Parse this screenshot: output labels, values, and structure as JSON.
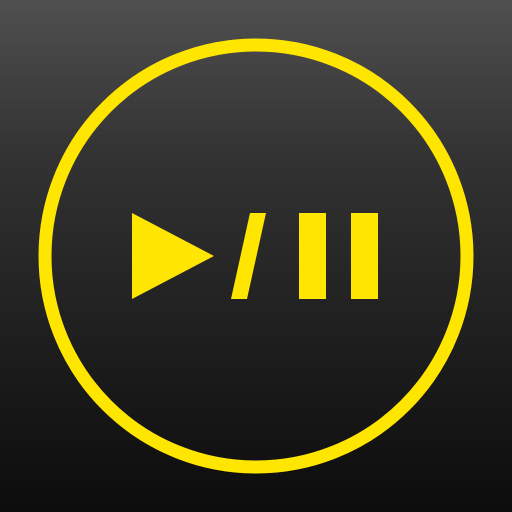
{
  "icon": {
    "name": "play-pause-icon",
    "accent_color": "#FFE600",
    "background_top": "#4f4f4f",
    "background_bottom": "#0c0c0c"
  }
}
